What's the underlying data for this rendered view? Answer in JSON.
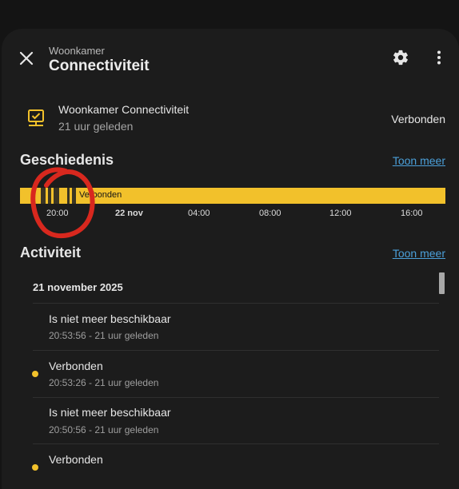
{
  "header": {
    "subtitle": "Woonkamer",
    "title": "Connectiviteit"
  },
  "entity": {
    "name": "Woonkamer Connectiviteit",
    "last_changed": "21 uur geleden",
    "state": "Verbonden"
  },
  "history": {
    "title": "Geschiedenis",
    "show_more": "Toon meer",
    "bar_label": "Verbonden",
    "ticks": [
      "20:00",
      "22 nov",
      "04:00",
      "08:00",
      "12:00",
      "16:00"
    ],
    "colors": {
      "connected": "#f2c12b",
      "unavailable": "#3a3524"
    }
  },
  "activity": {
    "title": "Activiteit",
    "show_more": "Toon meer",
    "date": "21 november 2025",
    "entries": [
      {
        "state": "Is niet meer beschikbaar",
        "time": "20:53:56 - 21 uur geleden"
      },
      {
        "state": "Verbonden",
        "time": "20:53:26 - 21 uur geleden"
      },
      {
        "state": "Is niet meer beschikbaar",
        "time": "20:50:56 - 21 uur geleden"
      },
      {
        "state": "Verbonden",
        "time": ""
      }
    ]
  }
}
